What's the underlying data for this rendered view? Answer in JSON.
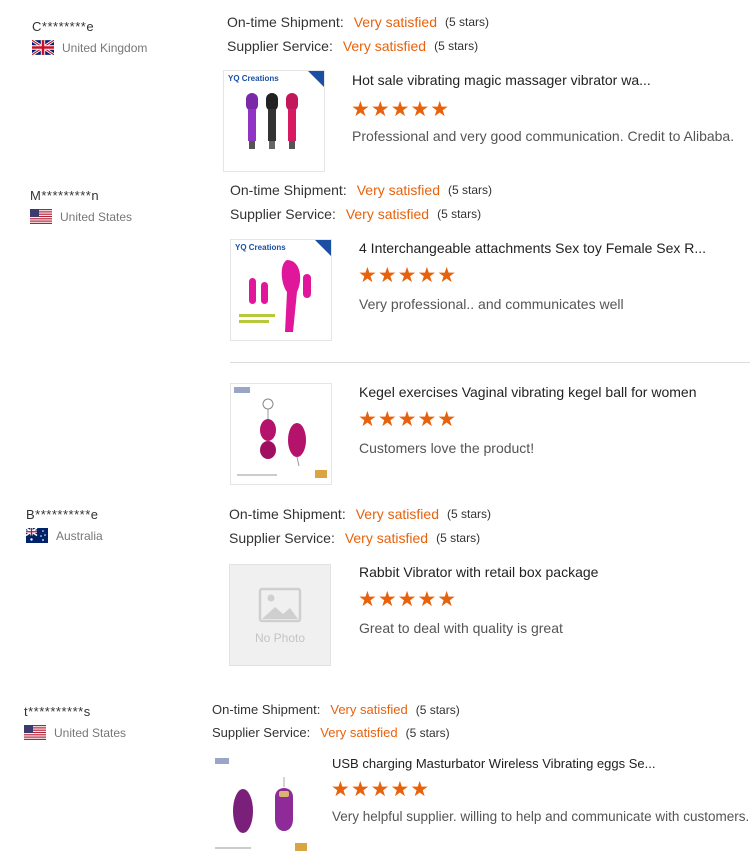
{
  "labels": {
    "shipment": "On-time Shipment:",
    "service": "Supplier Service:",
    "rating_value": "Very satisfied",
    "rating_stars": "(5 stars)",
    "product_stars": "★★★★★",
    "no_photo": "No Photo"
  },
  "colors": {
    "accent": "#e8620c",
    "brand_blue": "#1b4fa3"
  },
  "reviews": [
    {
      "buyer": "C********e",
      "country": "United Kingdom",
      "flag": "uk-flag",
      "products": [
        {
          "title": "Hot sale vibrating magic massager vibrator wa...",
          "comment": "Professional and very good communication. Credit to Alibaba.",
          "brand": "YQ Creations"
        }
      ]
    },
    {
      "buyer": "M*********n",
      "country": "United States",
      "flag": "us-flag",
      "products": [
        {
          "title": "4 Interchangeable attachments Sex toy Female Sex R...",
          "comment": "Very professional.. and communicates well",
          "brand": "YQ Creations"
        },
        {
          "title": "Kegel exercises Vaginal vibrating kegel ball for women",
          "comment": "Customers love the product!"
        }
      ]
    },
    {
      "buyer": "B**********e",
      "country": "Australia",
      "flag": "au-flag",
      "products": [
        {
          "title": "Rabbit Vibrator with retail box package",
          "comment": "Great to deal with quality is great"
        }
      ]
    },
    {
      "buyer": "t**********s",
      "country": "United States",
      "flag": "us-flag",
      "products": [
        {
          "title": "USB charging Masturbator Wireless Vibrating eggs Se...",
          "comment": "Very helpful supplier. willing to help and communicate with customers."
        }
      ]
    }
  ]
}
